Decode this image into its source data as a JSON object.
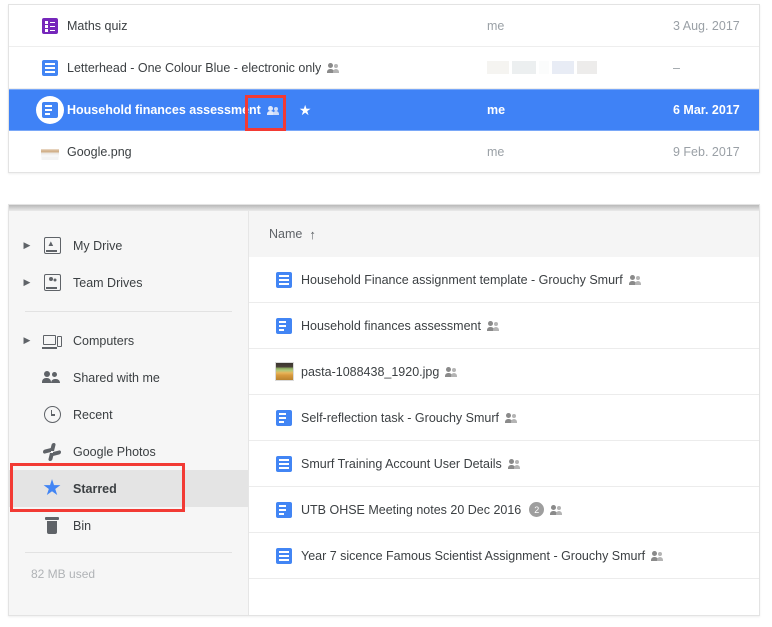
{
  "colors": {
    "selection_blue": "#3f82f6",
    "annotation_red": "#f23a34",
    "docs_blue": "#4285f4",
    "forms_purple": "#7627bb",
    "sidebar_bg": "#f6f6f6",
    "active_item_bg": "#e4e4e4"
  },
  "top_panel": {
    "rows": [
      {
        "icon": "google-forms-icon",
        "name": "Maths quiz",
        "shared": false,
        "starred": false,
        "owner": "me",
        "owner_redacted": false,
        "date": "3 Aug. 2017",
        "selected": false
      },
      {
        "icon": "google-docs-icon",
        "name": "Letterhead - One Colour Blue - electronic only",
        "shared": true,
        "starred": false,
        "owner": "",
        "owner_redacted": true,
        "date": "–",
        "selected": false
      },
      {
        "icon": "google-docs-icon",
        "name": "Household finances assessment",
        "shared": true,
        "starred": true,
        "star_glyph": "★",
        "owner": "me",
        "owner_redacted": false,
        "date": "6 Mar. 2017",
        "selected": true
      },
      {
        "icon": "png-thumbnail-icon",
        "name": "Google.png",
        "shared": false,
        "starred": false,
        "owner": "me",
        "owner_redacted": false,
        "date": "9 Feb. 2017",
        "selected": false
      }
    ]
  },
  "bottom_panel": {
    "sidebar": {
      "group1": [
        {
          "icon": "drive-icon",
          "label": "My Drive",
          "expandable": true,
          "active": false
        },
        {
          "icon": "team-drive-icon",
          "label": "Team Drives",
          "expandable": true,
          "active": false
        }
      ],
      "group2": [
        {
          "icon": "computers-icon",
          "label": "Computers",
          "expandable": true,
          "active": false
        },
        {
          "icon": "people-icon",
          "label": "Shared with me",
          "expandable": false,
          "active": false
        },
        {
          "icon": "clock-icon",
          "label": "Recent",
          "expandable": false,
          "active": false
        },
        {
          "icon": "google-photos-icon",
          "label": "Google Photos",
          "expandable": false,
          "active": false
        },
        {
          "icon": "star-icon",
          "label": "Starred",
          "expandable": false,
          "active": true
        },
        {
          "icon": "bin-icon",
          "label": "Bin",
          "expandable": false,
          "active": false
        }
      ],
      "storage_text": "82 MB used"
    },
    "list": {
      "header": {
        "column_label": "Name",
        "sort_arrow": "↑"
      },
      "rows": [
        {
          "icon": "google-docs-icon",
          "name": "Household Finance assignment template - Grouchy Smurf",
          "shared": true,
          "count": null
        },
        {
          "icon": "google-docs-icon",
          "name": "Household finances assessment",
          "shared": true,
          "count": null
        },
        {
          "icon": "image-thumbnail-icon",
          "name": "pasta-1088438_1920.jpg",
          "shared": true,
          "count": null
        },
        {
          "icon": "google-docs-icon",
          "name": "Self-reflection task - Grouchy Smurf",
          "shared": true,
          "count": null
        },
        {
          "icon": "google-docs-icon",
          "name": "Smurf Training Account User Details",
          "shared": true,
          "count": null
        },
        {
          "icon": "google-docs-icon",
          "name": "UTB OHSE Meeting notes 20 Dec 2016",
          "shared": true,
          "count": "2"
        },
        {
          "icon": "google-docs-icon",
          "name": "Year 7 sicence Famous Scientist Assignment - Grouchy Smurf",
          "shared": true,
          "count": null
        }
      ]
    }
  },
  "annotations": [
    {
      "name": "star-highlight-box",
      "target": "starred-toggle-on-selected-row"
    },
    {
      "name": "starred-nav-highlight-box",
      "target": "sidebar-item-starred"
    }
  ]
}
